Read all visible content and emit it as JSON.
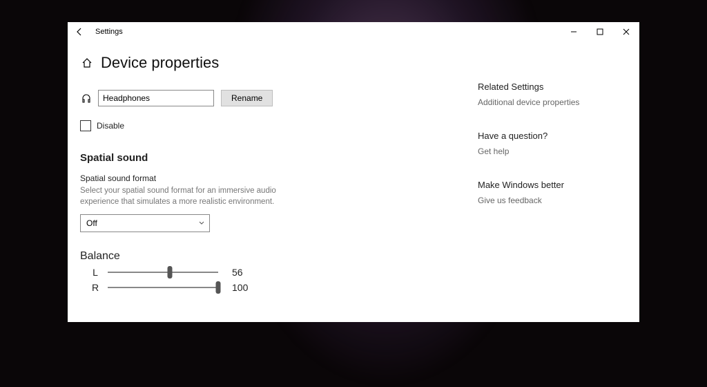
{
  "titlebar": {
    "title": "Settings"
  },
  "page": {
    "title": "Device properties"
  },
  "device": {
    "name": "Headphones",
    "rename_label": "Rename",
    "disable_label": "Disable",
    "disable_checked": false
  },
  "spatial": {
    "heading": "Spatial sound",
    "field_label": "Spatial sound format",
    "description": "Select your spatial sound format for an immersive audio experience that simulates a more realistic environment.",
    "selected": "Off"
  },
  "balance": {
    "heading": "Balance",
    "left_label": "L",
    "left_value": 56,
    "right_label": "R",
    "right_value": 100
  },
  "sidebar": {
    "blocks": [
      {
        "heading": "Related Settings",
        "link": "Additional device properties"
      },
      {
        "heading": "Have a question?",
        "link": "Get help"
      },
      {
        "heading": "Make Windows better",
        "link": "Give us feedback"
      }
    ]
  }
}
